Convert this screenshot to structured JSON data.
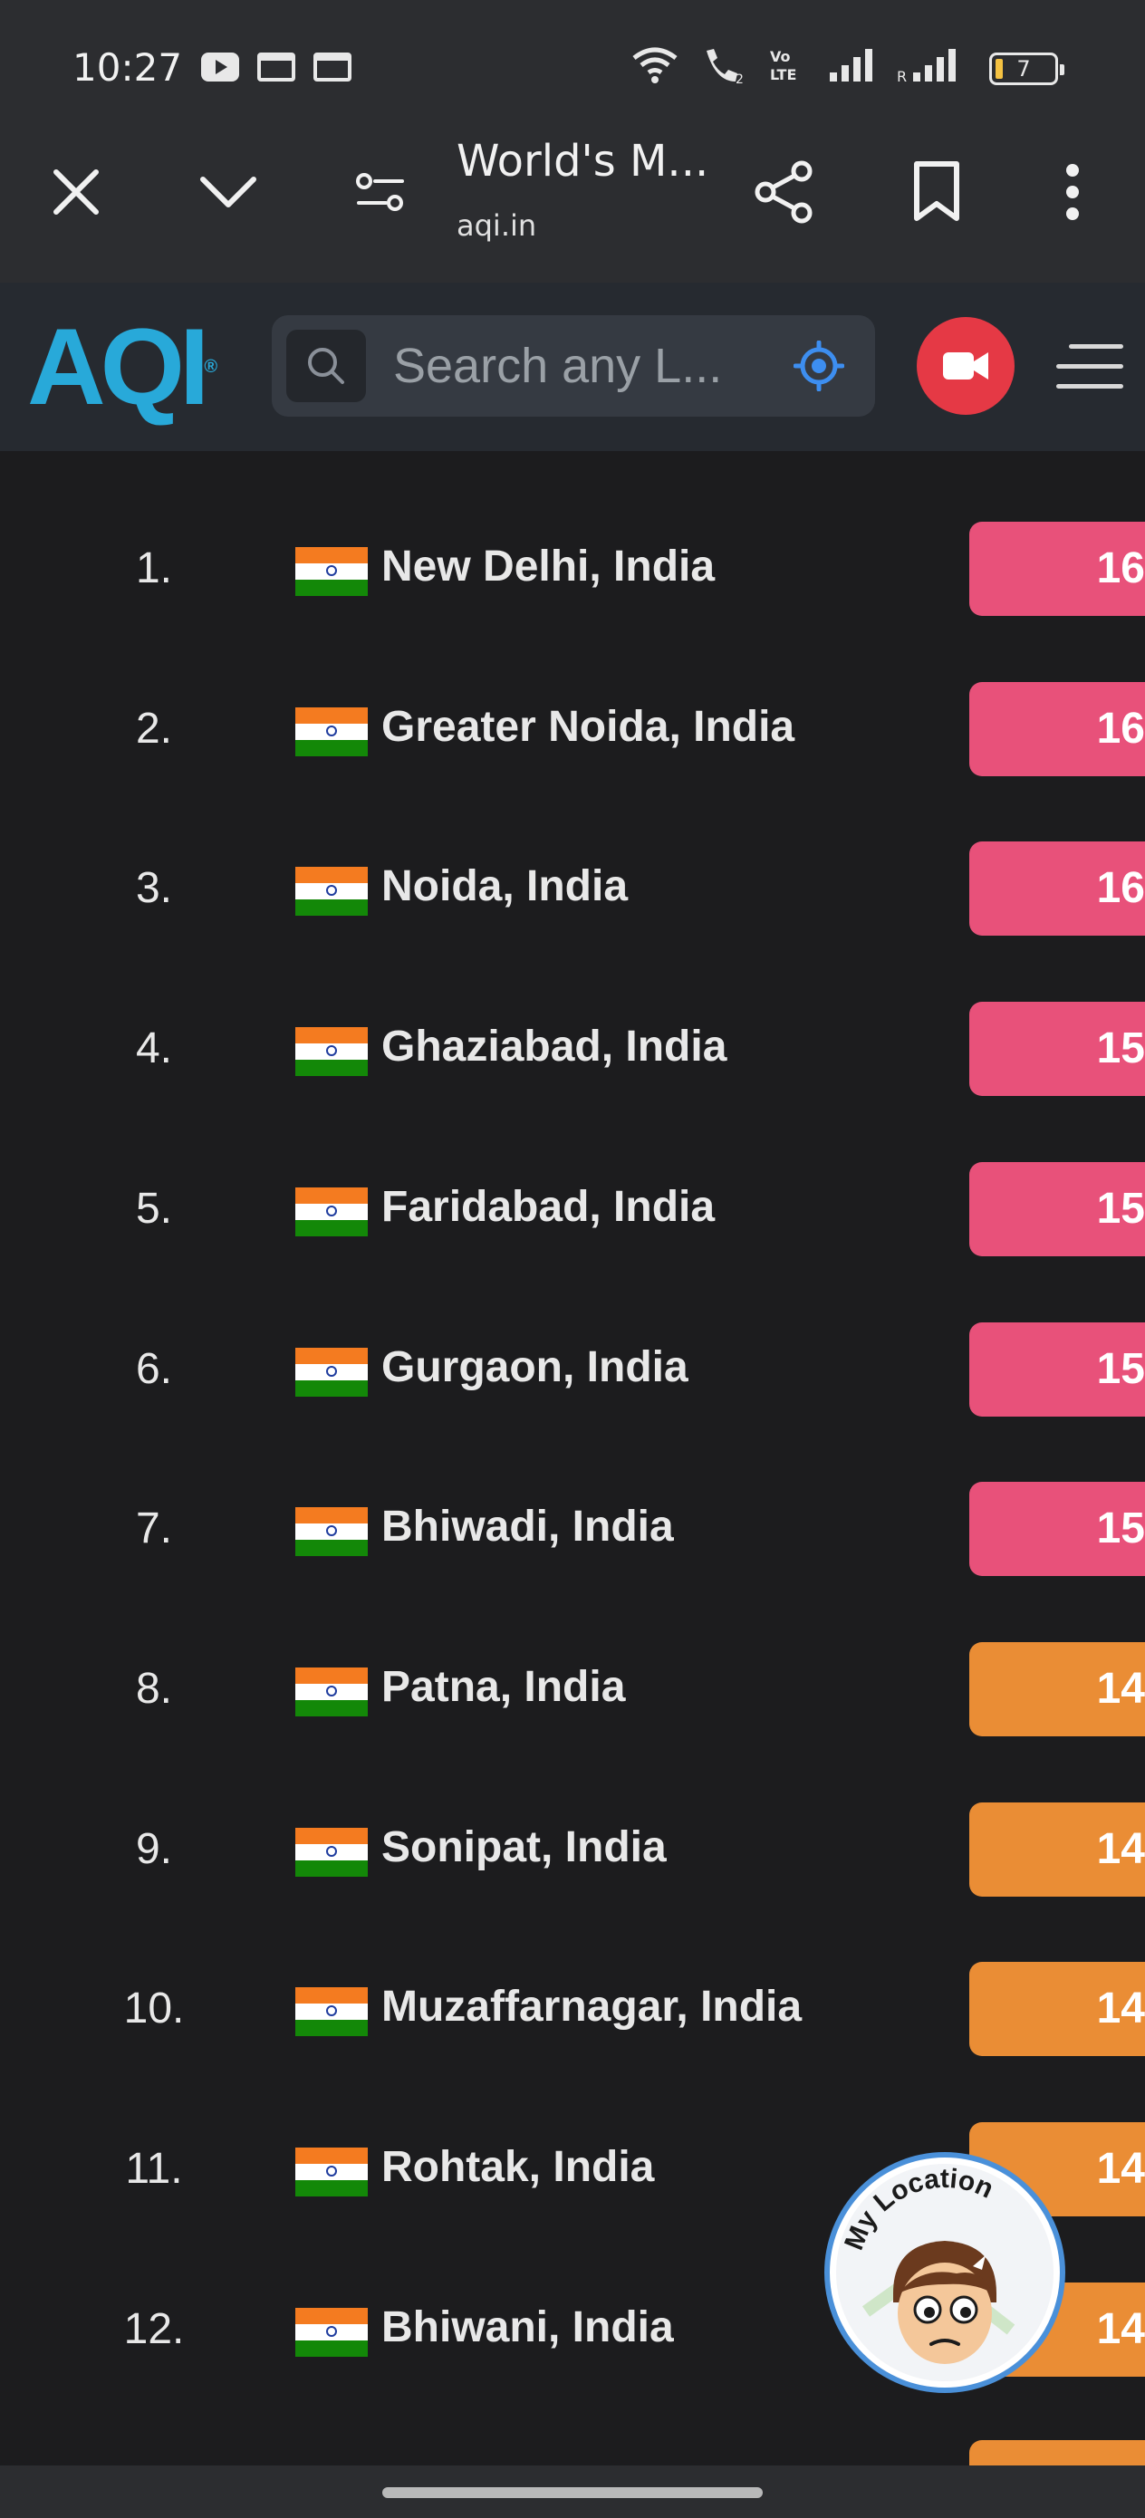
{
  "status_bar": {
    "time": "10:27",
    "battery": "7",
    "icons": [
      "youtube-icon",
      "calendar-icon",
      "calendar-icon",
      "wifi-icon",
      "wifi-calling-icon",
      "volte-icon",
      "signal-icon",
      "signal-icon"
    ]
  },
  "browser": {
    "page_title": "World's M...",
    "domain": "aqi.in",
    "buttons": [
      "close-icon",
      "chevron-down-icon",
      "page-info-icon",
      "share-icon",
      "bookmark-icon",
      "more-vert-icon"
    ]
  },
  "site_header": {
    "logo_text": "AQI",
    "logo_mark": "®",
    "search_placeholder": "Search any L...",
    "accent_color": "#28a9d9",
    "camera_color": "#e53945"
  },
  "rankings": [
    {
      "rank": "1.",
      "city": "New Delhi, India",
      "aqi": "16",
      "level_color": "#e8517a"
    },
    {
      "rank": "2.",
      "city": "Greater Noida, India",
      "aqi": "16",
      "level_color": "#e8517a"
    },
    {
      "rank": "3.",
      "city": "Noida, India",
      "aqi": "16",
      "level_color": "#e8517a"
    },
    {
      "rank": "4.",
      "city": "Ghaziabad, India",
      "aqi": "15",
      "level_color": "#e8517a"
    },
    {
      "rank": "5.",
      "city": "Faridabad, India",
      "aqi": "15",
      "level_color": "#e8517a"
    },
    {
      "rank": "6.",
      "city": "Gurgaon, India",
      "aqi": "15",
      "level_color": "#e8517a"
    },
    {
      "rank": "7.",
      "city": "Bhiwadi, India",
      "aqi": "15",
      "level_color": "#e8517a"
    },
    {
      "rank": "8.",
      "city": "Patna, India",
      "aqi": "14",
      "level_color": "#ea8d35"
    },
    {
      "rank": "9.",
      "city": "Sonipat, India",
      "aqi": "14",
      "level_color": "#ea8d35"
    },
    {
      "rank": "10.",
      "city": "Muzaffarnagar, India",
      "aqi": "14",
      "level_color": "#ea8d35"
    },
    {
      "rank": "11.",
      "city": "Rohtak, India",
      "aqi": "14",
      "level_color": "#ea8d35"
    },
    {
      "rank": "12.",
      "city": "Bhiwani, India",
      "aqi": "14",
      "level_color": "#ea8d35"
    }
  ],
  "my_location": {
    "label": "My Location"
  }
}
